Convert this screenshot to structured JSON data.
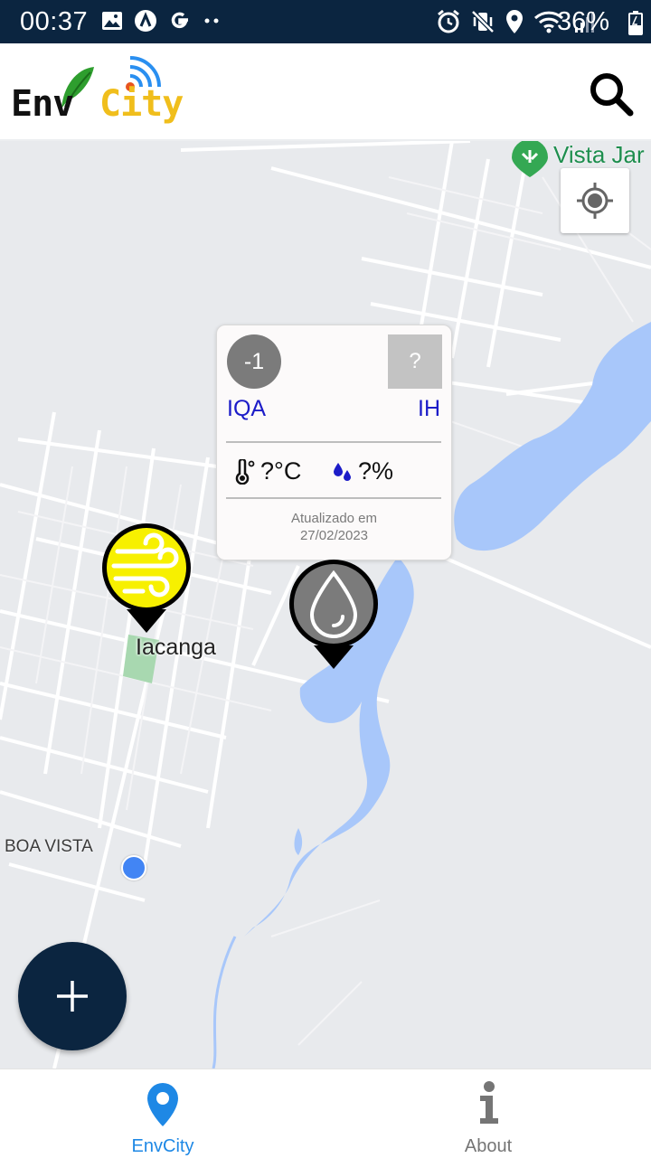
{
  "status_bar": {
    "time": "00:37",
    "left_icons": [
      "image-icon",
      "app-a-icon",
      "google-g-icon",
      "more-dots-icon"
    ],
    "right_icons": [
      "alarm-icon",
      "vibrate-off-icon",
      "location-icon",
      "wifi-icon",
      "signal-icon"
    ],
    "battery": "36%"
  },
  "header": {
    "logo_part1": "Env",
    "logo_part2": "City",
    "search_icon": "search-icon"
  },
  "map": {
    "labels": {
      "iacanga": "Iacanga",
      "boa_vista": "BOA VISTA",
      "vista_jar": "Vista Jar"
    },
    "locate_icon": "my-location-icon",
    "popup": {
      "iqa_value": "-1",
      "iqa_label": "IQA",
      "ih_value": "?",
      "ih_label": "IH",
      "temperature": "?°C",
      "humidity": "?%",
      "updated_line1": "Atualizado em",
      "updated_line2": "27/02/2023"
    },
    "markers": [
      {
        "name": "air-quality-marker",
        "icon": "wind-icon",
        "color": "#f7f000"
      },
      {
        "name": "water-marker",
        "icon": "water-drop-icon",
        "color": "#7b7b7b"
      }
    ]
  },
  "colors": {
    "status_bar": "#0b2540",
    "fab": "#0b2540",
    "active_tab": "#1e88e5",
    "water": "#a8c7fa"
  },
  "fab": {
    "icon": "plus-icon"
  },
  "bottom_nav": {
    "items": [
      {
        "label": "EnvCity",
        "icon": "map-pin-icon",
        "active": true
      },
      {
        "label": "About",
        "icon": "info-icon",
        "active": false
      }
    ]
  }
}
